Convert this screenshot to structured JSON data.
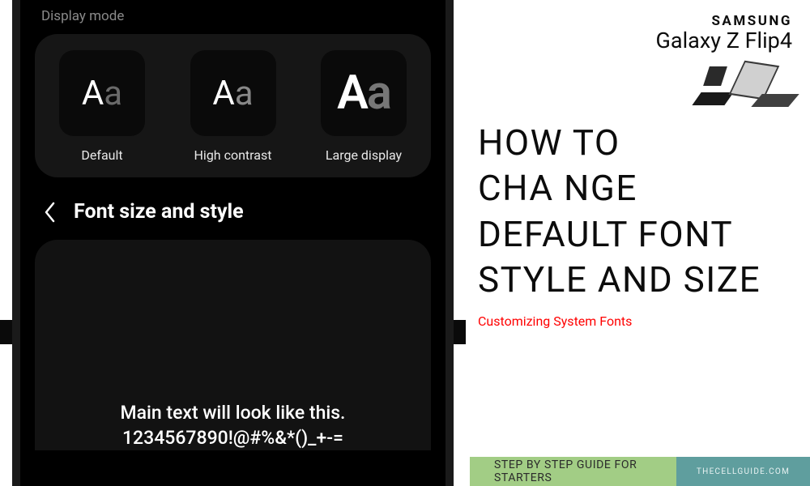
{
  "phone": {
    "section_label": "Display mode",
    "modes": [
      {
        "label": "Default"
      },
      {
        "label": "High contrast"
      },
      {
        "label": "Large display"
      }
    ],
    "nav_title": "Font size and style",
    "preview_line1": "Main text will look like this.",
    "preview_line2": "1234567890!@#%&*()_+-="
  },
  "brand": {
    "logo": "SAMSUNG",
    "product": "Galaxy Z Flip4"
  },
  "headline": {
    "line1": "HOW TO",
    "line2": "CHA NGE",
    "line3": "DEFAULT FONT",
    "line4": "STYLE AND SIZE"
  },
  "subhead": "Customizing System Fonts",
  "footer": {
    "guide": "STEP BY STEP GUIDE FOR STARTERS",
    "site": "THECELLGUIDE.COM"
  }
}
